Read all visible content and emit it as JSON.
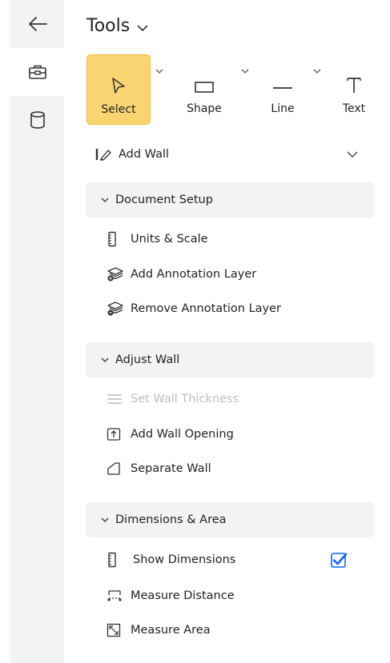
{
  "rail": {
    "items": [
      {
        "icon": "back-arrow-icon"
      },
      {
        "icon": "briefcase-icon",
        "active": true
      },
      {
        "icon": "database-icon"
      }
    ]
  },
  "panel": {
    "title": "Tools",
    "tools": [
      {
        "label": "Select",
        "icon": "cursor-icon",
        "selected": true
      },
      {
        "label": "Shape",
        "icon": "rectangle-icon"
      },
      {
        "label": "Line",
        "icon": "line-icon"
      },
      {
        "label": "Text",
        "icon": "text-icon"
      }
    ],
    "add_wall": {
      "label": "Add Wall"
    },
    "sections": [
      {
        "title": "Document Setup",
        "items": [
          {
            "label": "Units & Scale",
            "icon": "ruler-icon"
          },
          {
            "label": "Add Annotation Layer",
            "icon": "layers-add-icon"
          },
          {
            "label": "Remove Annotation Layer",
            "icon": "layers-remove-icon"
          }
        ]
      },
      {
        "title": "Adjust Wall",
        "items": [
          {
            "label": "Set Wall Thickness",
            "icon": "thickness-icon",
            "disabled": true
          },
          {
            "label": "Add Wall Opening",
            "icon": "wall-opening-icon"
          },
          {
            "label": "Separate Wall",
            "icon": "separate-wall-icon"
          }
        ]
      },
      {
        "title": "Dimensions & Area",
        "items": [
          {
            "label": "Show Dimensions",
            "icon": "ruler-icon",
            "checked": true
          },
          {
            "label": "Measure Distance",
            "icon": "measure-distance-icon"
          },
          {
            "label": "Measure Area",
            "icon": "measure-area-icon"
          }
        ]
      }
    ]
  },
  "colors": {
    "accent": "#f9d470",
    "accent_border": "#f0b93a",
    "checkbox": "#0f62fe",
    "section_bg": "#f3f3f3"
  }
}
